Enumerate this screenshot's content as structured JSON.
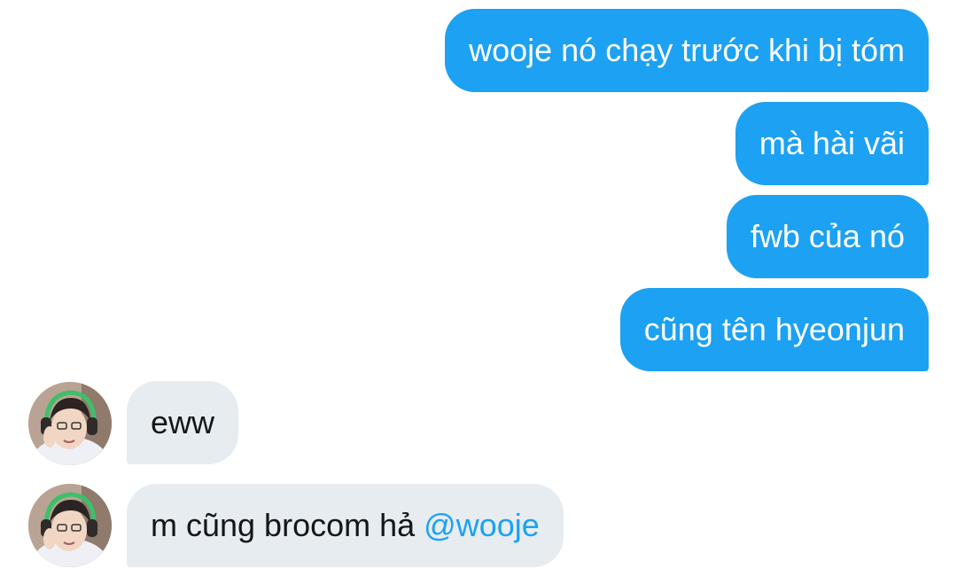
{
  "conversation": {
    "messages": [
      {
        "direction": "sent",
        "text": "wooje nó chạy trước khi bị tóm"
      },
      {
        "direction": "sent",
        "text": "mà hài vãi"
      },
      {
        "direction": "sent",
        "text": "fwb của nó"
      },
      {
        "direction": "sent",
        "text": "cũng tên hyeonjun"
      },
      {
        "direction": "received",
        "text": "eww",
        "avatar": "user-avatar-photo"
      },
      {
        "direction": "received",
        "text": "m cũng brocom hả ",
        "mention": "@wooje",
        "avatar": "user-avatar-photo"
      }
    ]
  },
  "colors": {
    "sent_bubble": "#1da1f2",
    "received_bubble": "#e6ecf0",
    "mention": "#1da1f2",
    "background": "#ffffff"
  }
}
